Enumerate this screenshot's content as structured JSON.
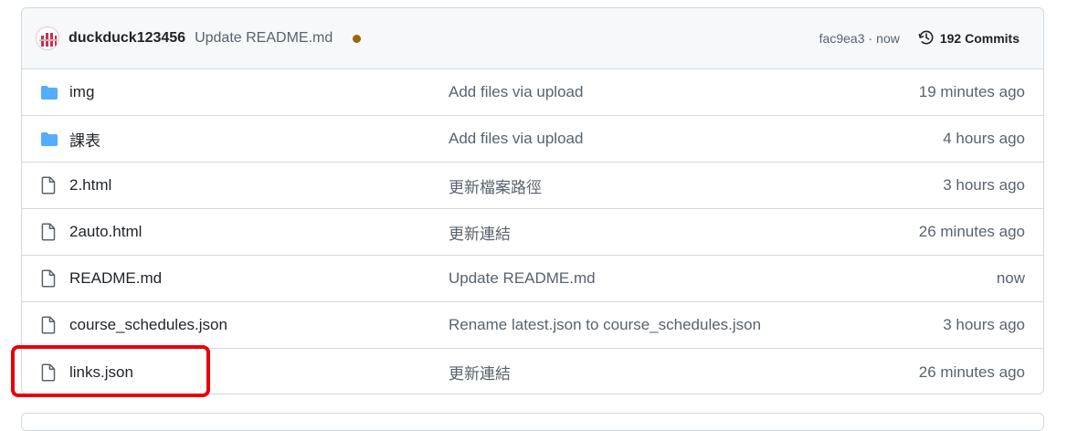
{
  "commit": {
    "author": "duckduck123456",
    "message": "Update README.md",
    "status_color": "#9a6700",
    "sha": "fac9ea3",
    "separator": "·",
    "when": "now",
    "commits_label": "192 Commits",
    "history_icon": "history-icon"
  },
  "colors": {
    "folder": "#54aeff",
    "file_icon": "#59636e",
    "highlight": "#e8000b"
  },
  "files": [
    {
      "type": "folder",
      "name": "img",
      "message": "Add files via upload",
      "time": "19 minutes ago"
    },
    {
      "type": "folder",
      "name": "課表",
      "message": "Add files via upload",
      "time": "4 hours ago"
    },
    {
      "type": "file",
      "name": "2.html",
      "message": "更新檔案路徑",
      "time": "3 hours ago"
    },
    {
      "type": "file",
      "name": "2auto.html",
      "message": "更新連結",
      "time": "26 minutes ago"
    },
    {
      "type": "file",
      "name": "README.md",
      "message": "Update README.md",
      "time": "now"
    },
    {
      "type": "file",
      "name": "course_schedules.json",
      "message": "Rename latest.json to course_schedules.json",
      "time": "3 hours ago"
    },
    {
      "type": "file",
      "name": "links.json",
      "message": "更新連結",
      "time": "26 minutes ago"
    }
  ]
}
